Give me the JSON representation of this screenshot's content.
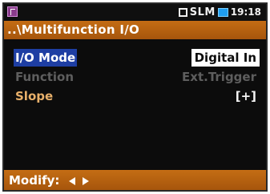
{
  "status": {
    "mode": "SLM",
    "time": "19:18",
    "icons": [
      "app-menu-icon",
      "mode-box-icon",
      "battery-icon"
    ]
  },
  "header": {
    "title": "..\\Multifunction I/O"
  },
  "menu": {
    "items": [
      {
        "label": "I/O Mode",
        "value": "Digital In",
        "state": "selected"
      },
      {
        "label": "Function",
        "value": "Ext.Trigger",
        "state": "disabled"
      },
      {
        "label": "Slope",
        "value": "[+]",
        "state": "normal"
      }
    ]
  },
  "footer": {
    "label": "Modify:",
    "icons": [
      "arrow-left-icon",
      "arrow-right-icon"
    ]
  },
  "colors": {
    "accent": "#c46d14",
    "selection_label_bg": "#1e3ea3",
    "selection_value_bg": "#ffffff",
    "label_color": "#e8b06a",
    "disabled_color": "#5e5e5e",
    "background": "#0c0c0c"
  }
}
